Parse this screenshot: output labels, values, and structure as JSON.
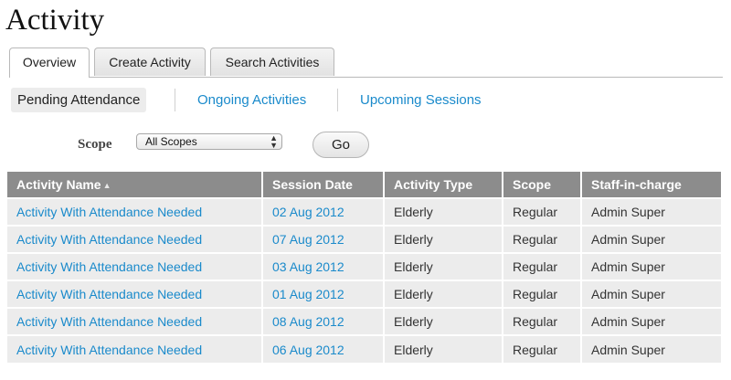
{
  "page": {
    "title": "Activity"
  },
  "tabs": [
    {
      "label": "Overview",
      "active": true
    },
    {
      "label": "Create Activity",
      "active": false
    },
    {
      "label": "Search Activities",
      "active": false
    }
  ],
  "subnav": [
    {
      "label": "Pending Attendance",
      "active": true
    },
    {
      "label": "Ongoing Activities",
      "active": false
    },
    {
      "label": "Upcoming Sessions",
      "active": false
    }
  ],
  "filter": {
    "scope_label": "Scope",
    "scope_value": "All Scopes",
    "go_label": "Go"
  },
  "table": {
    "columns": [
      "Activity Name",
      "Session Date",
      "Activity Type",
      "Scope",
      "Staff-in-charge"
    ],
    "sorted_column": "Activity Name",
    "sort_direction": "ascending",
    "rows": [
      [
        "Activity With Attendance Needed",
        "02 Aug 2012",
        "Elderly",
        "Regular",
        "Admin Super"
      ],
      [
        "Activity With Attendance Needed",
        "07 Aug 2012",
        "Elderly",
        "Regular",
        "Admin Super"
      ],
      [
        "Activity With Attendance Needed",
        "03 Aug 2012",
        "Elderly",
        "Regular",
        "Admin Super"
      ],
      [
        "Activity With Attendance Needed",
        "01 Aug 2012",
        "Elderly",
        "Regular",
        "Admin Super"
      ],
      [
        "Activity With Attendance Needed",
        "08 Aug 2012",
        "Elderly",
        "Regular",
        "Admin Super"
      ],
      [
        "Activity With Attendance Needed",
        "06 Aug 2012",
        "Elderly",
        "Regular",
        "Admin Super"
      ]
    ]
  },
  "colors": {
    "link": "#1a8acb",
    "header_bg": "#8c8c8c",
    "row_bg": "#ececec"
  }
}
